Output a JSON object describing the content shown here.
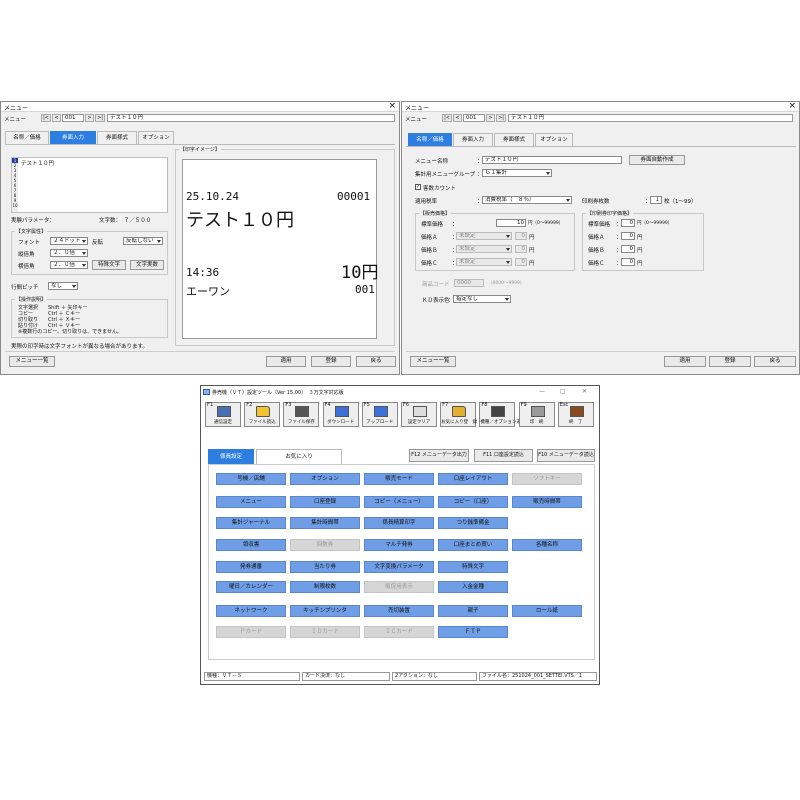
{
  "left_window": {
    "title": "メニュー",
    "nav": {
      "label": "メニュー",
      "btn_first": "|<",
      "btn_prev": "<",
      "number": "001",
      "btn_next": ">",
      "btn_last": ">|",
      "name": "テスト１０円"
    },
    "tabs": [
      "名称／価格",
      "券面入力",
      "券面様式",
      "オプション"
    ],
    "active_tab": 1,
    "list": {
      "numbers": [
        "1",
        "2",
        "3",
        "4",
        "5",
        "6",
        "7",
        "8",
        "9",
        "10"
      ],
      "first_line": "テスト１０円"
    },
    "status_left": "実験パラメータ：",
    "status_right": "文字数：　７／５００",
    "char_attr": {
      "title": "【文字属性】",
      "font_label": "フォント",
      "font_value": "２４ドット",
      "invert_label": "反転",
      "invert_value": "反転しない",
      "vertical_label": "縦倍角",
      "vertical_value": "２．０倍",
      "horizontal_label": "横倍角",
      "horizontal_value": "２．０倍",
      "special_button": "特殊文字",
      "fixed_button": "文字実数"
    },
    "line_pitch_label": "行間ピッチ",
    "line_pitch_value": "なし",
    "help": {
      "title": "【操作説明】",
      "lines": [
        "文字選択　　Shift ＋ 矢印キー",
        "コピー　　　Ctrl ＋ Ｃキー",
        "切り取り　　Ctrl ＋ Ｘキー",
        "貼り付け　　Ctrl ＋ Ｖキー",
        "※複数行のコピー、切り取りは、できません。"
      ]
    },
    "footnote": "実際の印字時は文字フォントが異なる場合があります。",
    "preview": {
      "title": "【印字イメージ】",
      "date": "25.10.24",
      "serial": "00001",
      "headline": "テスト１０円",
      "time": "14:36",
      "price": "10円",
      "shop": "エーワン",
      "code": "001"
    },
    "menu_list_button": "メニュー一覧",
    "apply_button": "適用",
    "register_button": "登録",
    "back_button": "戻る"
  },
  "right_window": {
    "title": "メニュー",
    "nav": {
      "label": "メニュー",
      "btn_first": "|<",
      "btn_prev": "<",
      "number": "001",
      "btn_next": ">",
      "btn_last": ">|",
      "name": "テスト１０円"
    },
    "tabs": [
      "名称／価格",
      "券面入力",
      "券面様式",
      "オプション"
    ],
    "active_tab": 0,
    "menu_name_label": "メニュー名称",
    "menu_name_value": "テスト１０円",
    "auto_button": "券面自動作成",
    "group_label": "集計用メニューグループ",
    "group_value": "Ｇ１集計",
    "count_checkbox": "客数カウント",
    "tax_label": "適用税率",
    "tax_value": "消費税率（　８％）",
    "copies_label": "印刷券枚数",
    "copies_value": "１",
    "copies_hint": "枚（1～99）",
    "sales_group": {
      "title": "【販売価格】",
      "std_label": "標準価格",
      "std_value": "10",
      "std_hint": "円（0～99999）",
      "a_label": "価格Ａ",
      "b_label": "価格Ｂ",
      "c_label": "価格Ｃ",
      "unset": "未設定",
      "zero": "0",
      "yen": "円"
    },
    "print_group": {
      "title": "【印刷券印字価格】",
      "std_label": "標準価格",
      "std_hint": "円（0～99999）",
      "a_label": "価格Ａ",
      "b_label": "価格Ｂ",
      "c_label": "価格Ｃ",
      "zero": "0",
      "yen": "円"
    },
    "product_code_label": "商品コード",
    "product_code_value": "0000",
    "product_code_hint": "（0000～9999）",
    "kd_label": "ＫＤ表示色",
    "kd_value": "指定なし",
    "menu_list_button": "メニュー一覧",
    "apply_button": "適用",
    "register_button": "登録",
    "back_button": "戻る"
  },
  "tool_window": {
    "title": "券売機（ＶＴ）設定ツール（Ver 15.00）　３万文字対応版",
    "toolbar": [
      {
        "key": "F1",
        "label": "通信設定",
        "icon": "pc-icon"
      },
      {
        "key": "F2",
        "label": "ファイル読込",
        "icon": "folder-icon"
      },
      {
        "key": "F3",
        "label": "ファイル保存",
        "icon": "disk-icon"
      },
      {
        "key": "F4",
        "label": "ダウンロード",
        "icon": "download-icon"
      },
      {
        "key": "F5",
        "label": "アップロード",
        "icon": "upload-icon"
      },
      {
        "key": "F6",
        "label": "設定クリア",
        "icon": "clear-icon"
      },
      {
        "key": "F7",
        "label": "お気に入り登　録",
        "icon": "favorite-folder-icon"
      },
      {
        "key": "F8",
        "label": "機種／オプション選択",
        "icon": "select-icon"
      },
      {
        "key": "F9",
        "label": "印　刷",
        "icon": "printer-icon"
      },
      {
        "key": "Esc",
        "label": "終　了",
        "icon": "exit-icon"
      }
    ],
    "tabs": [
      "係員設定",
      "お気に入り"
    ],
    "func_buttons": [
      "F12 メニューデータ出力",
      "F11 口座設定読込",
      "F10 メニューデータ読込"
    ],
    "grid_rows": [
      [
        {
          "t": "号機／店舗",
          "d": false
        },
        {
          "t": "オプション",
          "d": false
        },
        {
          "t": "販売モード",
          "d": false
        },
        {
          "t": "口座レイアウト",
          "d": false
        },
        {
          "t": "ソフトキー",
          "d": true
        }
      ],
      [
        {
          "t": "メニュー",
          "d": false
        },
        {
          "t": "口座登録",
          "d": false
        },
        {
          "t": "コピー（メニュー）",
          "d": false
        },
        {
          "t": "コピー（口座）",
          "d": false
        },
        {
          "t": "販売時間帯",
          "d": false
        }
      ],
      [
        {
          "t": "集計ジャーナル",
          "d": false
        },
        {
          "t": "集計時間帯",
          "d": false
        },
        {
          "t": "係員精算印字",
          "d": false
        },
        {
          "t": "つり銭準備金",
          "d": false
        }
      ],
      [
        {
          "t": "領収書",
          "d": false
        },
        {
          "t": "回数券",
          "d": true
        },
        {
          "t": "マルチ発券",
          "d": false
        },
        {
          "t": "口座まとめ買い",
          "d": false
        },
        {
          "t": "各種名称",
          "d": false
        }
      ],
      [
        {
          "t": "発券通番",
          "d": false
        },
        {
          "t": "当たり券",
          "d": false
        },
        {
          "t": "文字変換パラメータ",
          "d": false
        },
        {
          "t": "特殊文字",
          "d": false
        }
      ],
      [
        {
          "t": "曜日／カレンダー",
          "d": false
        },
        {
          "t": "制限枚数",
          "d": false
        },
        {
          "t": "販促用表示",
          "d": true
        },
        {
          "t": "入金金種",
          "d": false
        }
      ],
      [
        {
          "t": "ネットワーク",
          "d": false
        },
        {
          "t": "キッチンプリンタ",
          "d": false
        },
        {
          "t": "売切装置",
          "d": false
        },
        {
          "t": "親子",
          "d": false
        },
        {
          "t": "ロール紙",
          "d": false
        }
      ],
      [
        {
          "t": "Ｐカード",
          "d": true
        },
        {
          "t": "ＩＤカード",
          "d": true
        },
        {
          "t": "ＩＣカード",
          "d": true
        },
        {
          "t": "ＦＴＰ",
          "d": false
        }
      ]
    ],
    "status": [
      "機種：ＶＴ－Ｓ",
      "カード決済：なし",
      "2アクション：なし",
      "ファイル名：251024_001_SETTEI.VTS／1"
    ],
    "window_controls": [
      "—",
      "□",
      "✕"
    ]
  }
}
